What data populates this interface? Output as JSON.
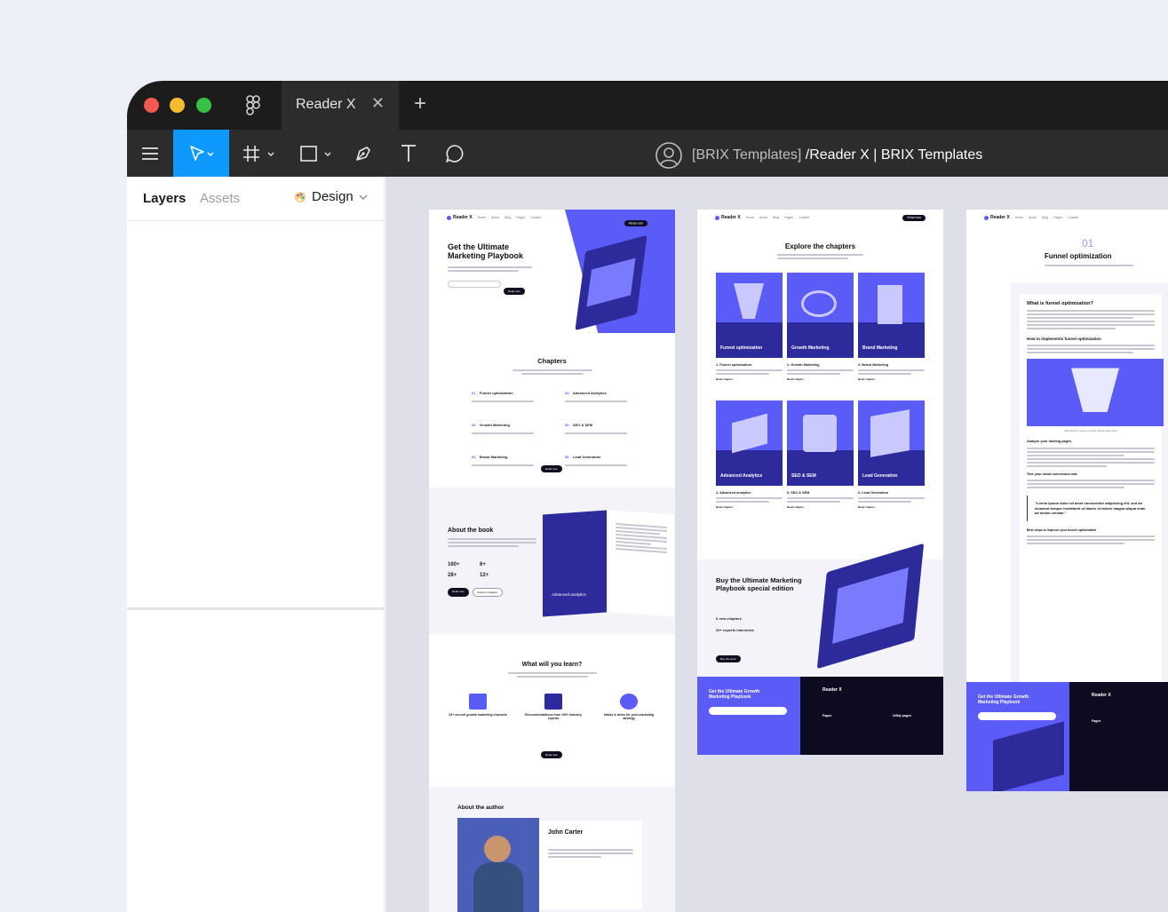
{
  "window": {
    "tab_title": "Reader X",
    "tab_close": "✕",
    "new_tab": "+",
    "doc_team": "[BRIX Templates]",
    "doc_name": "/Reader X | BRIX Templates"
  },
  "panel": {
    "layers_tab": "Layers",
    "assets_tab": "Assets",
    "design_label": "Design"
  },
  "home": {
    "logo": "Reader X",
    "nav": [
      "Home",
      "About",
      "Blog",
      "Pages",
      "Contact"
    ],
    "nav_cta": "Read now",
    "hero_title": "Get the Ultimate Marketing Playbook",
    "chapters_title": "Chapters",
    "chapters": [
      "Funnel optimization",
      "Advanced Analytics",
      "Growth Marketing",
      "SEO & SEM",
      "Brand Marketing",
      "Lead Generation"
    ],
    "chapter_nums": [
      "01",
      "02",
      "03",
      "04",
      "05",
      "06"
    ],
    "read_now": "Read now",
    "about_title": "About the book",
    "stats": [
      "160+",
      "6+",
      "28+",
      "12+"
    ],
    "about_btn1": "Read now",
    "about_btn2": "Explore chapters",
    "spread_label": "Advanced analytics",
    "learn_title": "What  will you learn?",
    "learn_items": [
      "20+ current growth marketing channels",
      "Recommendations from 100+ industry experts",
      "Hacks & tricks for your marketing strategy"
    ],
    "author_section": "About the author",
    "author_name": "John Carter"
  },
  "chapters_page": {
    "title": "Explore the chapters",
    "cards": [
      "Funnel optimization",
      "Growth Marketing",
      "Brand Marketing",
      "Advanced Analytics",
      "SEO & SEM",
      "Lead Generation"
    ],
    "card_titles": [
      "1. Funnel optimization",
      "2. Growth Marketing",
      "3. Brand Marketing",
      "4. Advanced analytics",
      "5. SEO & SEM",
      "6. Lead Generation"
    ],
    "read_chapter": "Read chapter",
    "buy_title": "Buy the Ultimate Marketing Playbook special edition",
    "buy_points": [
      "6 new chapters",
      "20+ experts interviews"
    ],
    "buy_btn": "Buy the book",
    "footer_cta": "Get the Ultimate Growth Marketing Playbook",
    "footer_logo": "Reader X",
    "footer_col1": "Pages",
    "footer_col2": "Utility pages"
  },
  "article_page": {
    "chapter_num": "01",
    "title": "Funnel optimization",
    "h_what": "What is funnel optimization?",
    "h_how": "How to implements funnel optimization",
    "caption": "Odit facilius mouse of amet reduce ratio dolor",
    "h_analyze": "Analyze your landing pages",
    "h_test": "Test your email conversion rate",
    "quote": "\"Lorem ipsum dolor sit amet consectetur adipiscing elit, sed do eiusmod tempor incididunt ut labore et dolore magna aliqua enim ad minim veniam.\"",
    "h_best": "Best steps to improve your funnel optimization",
    "footer_cta": "Get the Ultimate Growth Marketing Playbook",
    "footer_logo": "Reader X",
    "footer_col1": "Pages"
  },
  "colors": {
    "accent": "#5b5bf7",
    "navy": "#2d2a9c",
    "toolbar": "#2c2c2c",
    "selected_tool": "#0d99ff"
  }
}
